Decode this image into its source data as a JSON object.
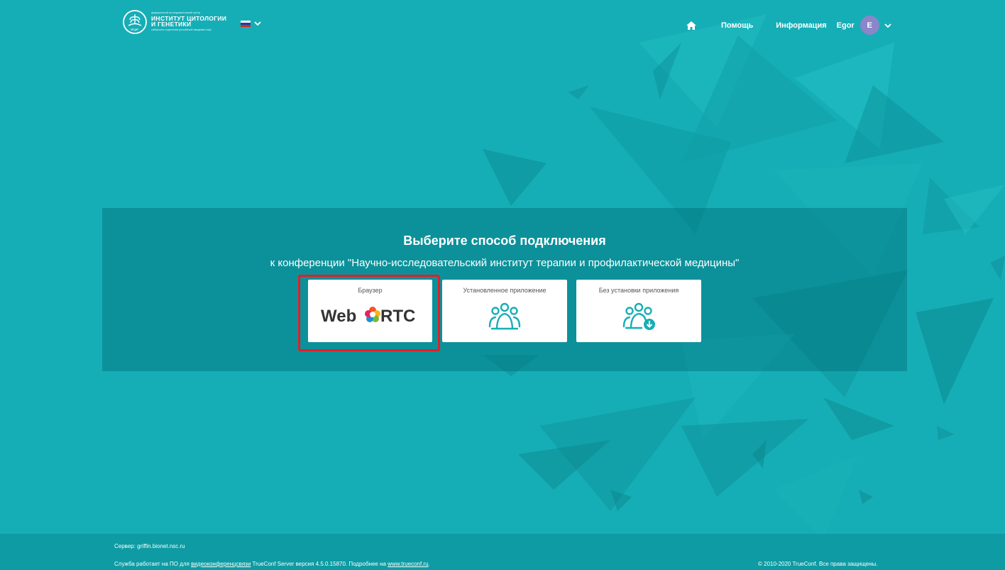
{
  "header": {
    "logo": {
      "top_text": "федеральный исследовательский центр",
      "line1": "ИНСТИТУТ ЦИТОЛОГИИ",
      "line2": "И ГЕНЕТИКИ",
      "bottom_text": "сибирского отделения российской академии наук",
      "emblem_text": "ИЦиГ"
    },
    "language": {
      "selected": "ru",
      "flag_colors": [
        "#ffffff",
        "#1c3fa8",
        "#d52b1e"
      ]
    },
    "nav": {
      "home_icon": "home-icon",
      "help": "Помощь",
      "info": "Информация",
      "user_name": "Egor",
      "avatar_letter": "E",
      "avatar_color": "#8a86c9"
    }
  },
  "main": {
    "title": "Выберите способ подключения",
    "subtitle": "к конференции \"Научно-исследовательский институт терапии и профилактической медицины\"",
    "options": [
      {
        "label": "Браузер",
        "logo_text_left": "Web",
        "logo_text_right": "RTC",
        "selected": true
      },
      {
        "label": "Установленное приложение",
        "icon": "people-icon"
      },
      {
        "label": "Без установки приложения",
        "icon": "people-download-icon"
      }
    ],
    "highlight_color": "#e31f26",
    "accent_color": "#16aeb6"
  },
  "footer": {
    "server": "Сервер: griffin.bionet.nsc.ru",
    "service_prefix": "Служба работает на ПО для ",
    "service_link": "видеоконференцсвязи",
    "service_middle": " TrueConf Server версия 4.5.0.15870. Подробнее на ",
    "service_site": "www.trueconf.ru",
    "service_end": ".",
    "copyright": "© 2010-2020 TrueConf. Все права защищены."
  }
}
